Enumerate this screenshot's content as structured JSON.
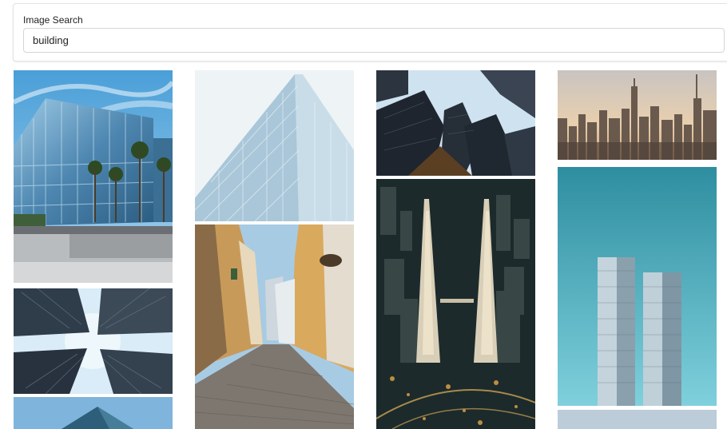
{
  "search": {
    "label": "Image Search",
    "value": "building"
  },
  "results": [
    {
      "name": "result-image-glass-office-palms",
      "icon": "glass-office-building-image"
    },
    {
      "name": "result-image-skyscrapers-looking-up",
      "icon": "skyscrapers-upward-view-image"
    },
    {
      "name": "result-image-building-partial",
      "icon": "building-image"
    },
    {
      "name": "result-image-glass-facade",
      "icon": "glass-facade-image"
    },
    {
      "name": "result-image-cobblestone-street",
      "icon": "old-town-street-image"
    },
    {
      "name": "result-image-dark-towers",
      "icon": "dark-towers-image"
    },
    {
      "name": "result-image-petronas-towers-night",
      "icon": "twin-towers-night-image"
    },
    {
      "name": "result-image-city-skyline",
      "icon": "city-skyline-image"
    },
    {
      "name": "result-image-twin-towers-teal",
      "icon": "twin-towers-minimal-image"
    },
    {
      "name": "result-image-partial-bottom",
      "icon": "building-image"
    }
  ]
}
